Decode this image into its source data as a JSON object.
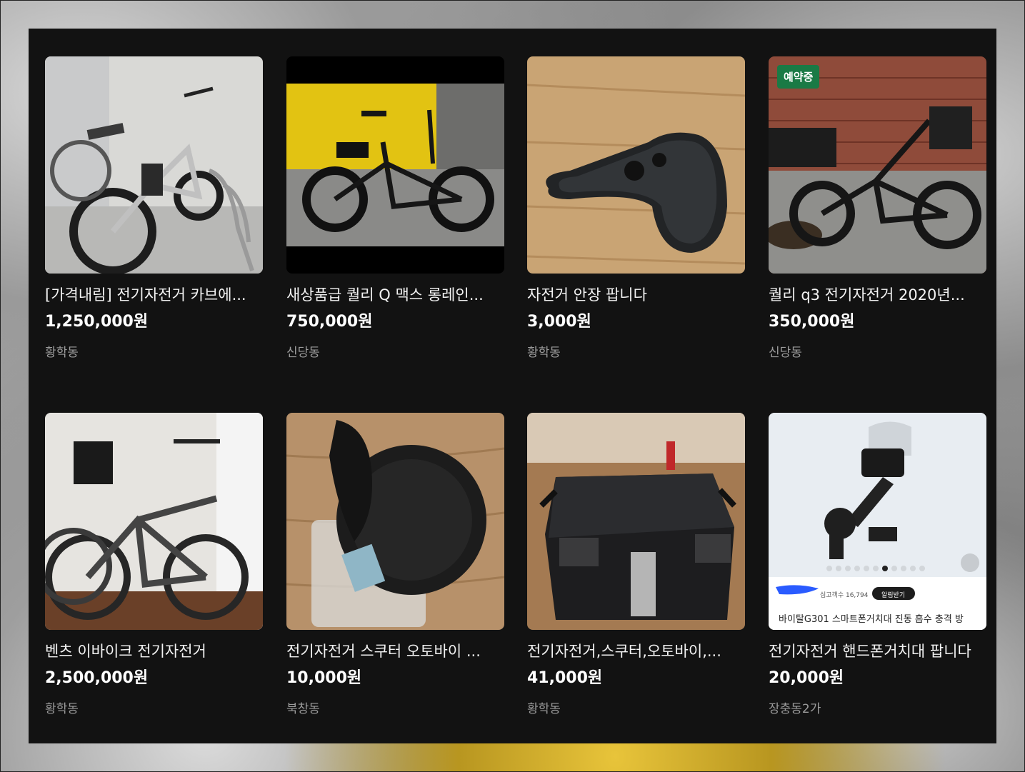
{
  "listings": [
    {
      "title": "[가격내림] 전기자전거 카브에...",
      "price": "1,250,000원",
      "region": "황학동",
      "badge": ""
    },
    {
      "title": "새상품급 퀄리 Q 맥스 롱레인...",
      "price": "750,000원",
      "region": "신당동",
      "badge": ""
    },
    {
      "title": "자전거 안장 팝니다",
      "price": "3,000원",
      "region": "황학동",
      "badge": ""
    },
    {
      "title": "퀄리 q3 전기자전거 2020년...",
      "price": "350,000원",
      "region": "신당동",
      "badge": "예약중"
    },
    {
      "title": "벤츠 이바이크 전기자전거",
      "price": "2,500,000원",
      "region": "황학동",
      "badge": ""
    },
    {
      "title": "전기자전거 스쿠터 오토바이 ...",
      "price": "10,000원",
      "region": "북창동",
      "badge": ""
    },
    {
      "title": "전기자전거,스쿠터,오토바이,...",
      "price": "41,000원",
      "region": "황학동",
      "badge": ""
    },
    {
      "title": "전기자전거 핸드폰거치대 팝니다",
      "price": "20,000원",
      "region": "장충동2가",
      "badge": ""
    }
  ],
  "thumb_texts": {
    "view_count": "심고객수 16,794",
    "notify": "알림받기",
    "product_caption": "바이탈G301 스마트폰거치대 진동 흡수 충격 방"
  },
  "colors": {
    "panel_bg": "#121212",
    "badge_bg": "#1a7a45",
    "region_text": "#9c9c9c"
  }
}
